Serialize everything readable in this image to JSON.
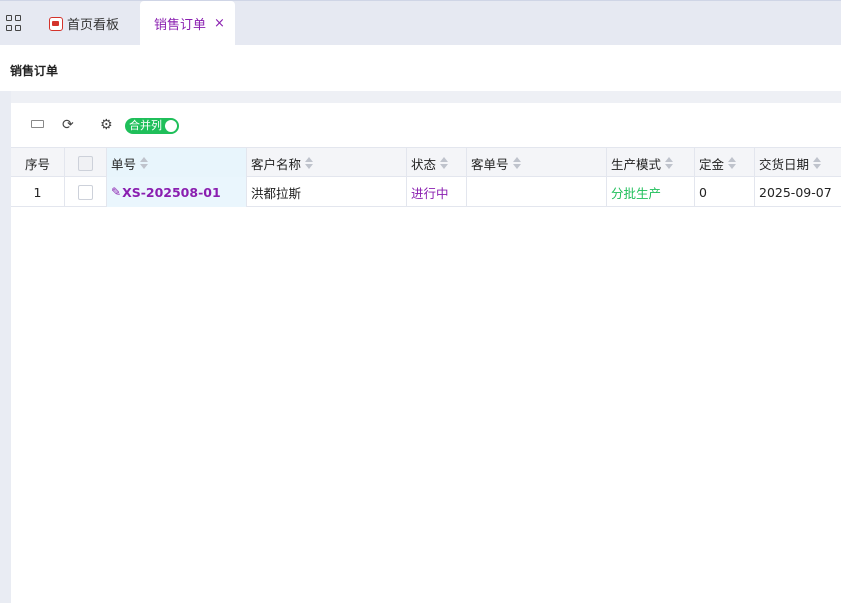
{
  "tabs": [
    {
      "label": "首页看板",
      "active": false,
      "icon": "dashboard-icon"
    },
    {
      "label": "销售订单",
      "active": true,
      "close": "×"
    }
  ],
  "page": {
    "title": "销售订单"
  },
  "toolbar": {
    "icons": [
      "keyboard-icon",
      "refresh-icon",
      "gear-icon"
    ],
    "toggle_label": "合并列",
    "toggle_on": true
  },
  "table": {
    "columns": [
      "序号",
      "",
      "单号",
      "客户名称",
      "状态",
      "客单号",
      "生产模式",
      "定金",
      "交货日期"
    ],
    "rows": [
      {
        "seq": "1",
        "order_no": "XS-202508-01",
        "customer": "洪都拉斯",
        "status": "进行中",
        "customer_order_no": "",
        "mode": "分批生产",
        "deposit": "0",
        "delivery_date": "2025-09-07"
      }
    ]
  },
  "colors": {
    "accent": "#8a1fb0",
    "green": "#1fbf5a"
  }
}
